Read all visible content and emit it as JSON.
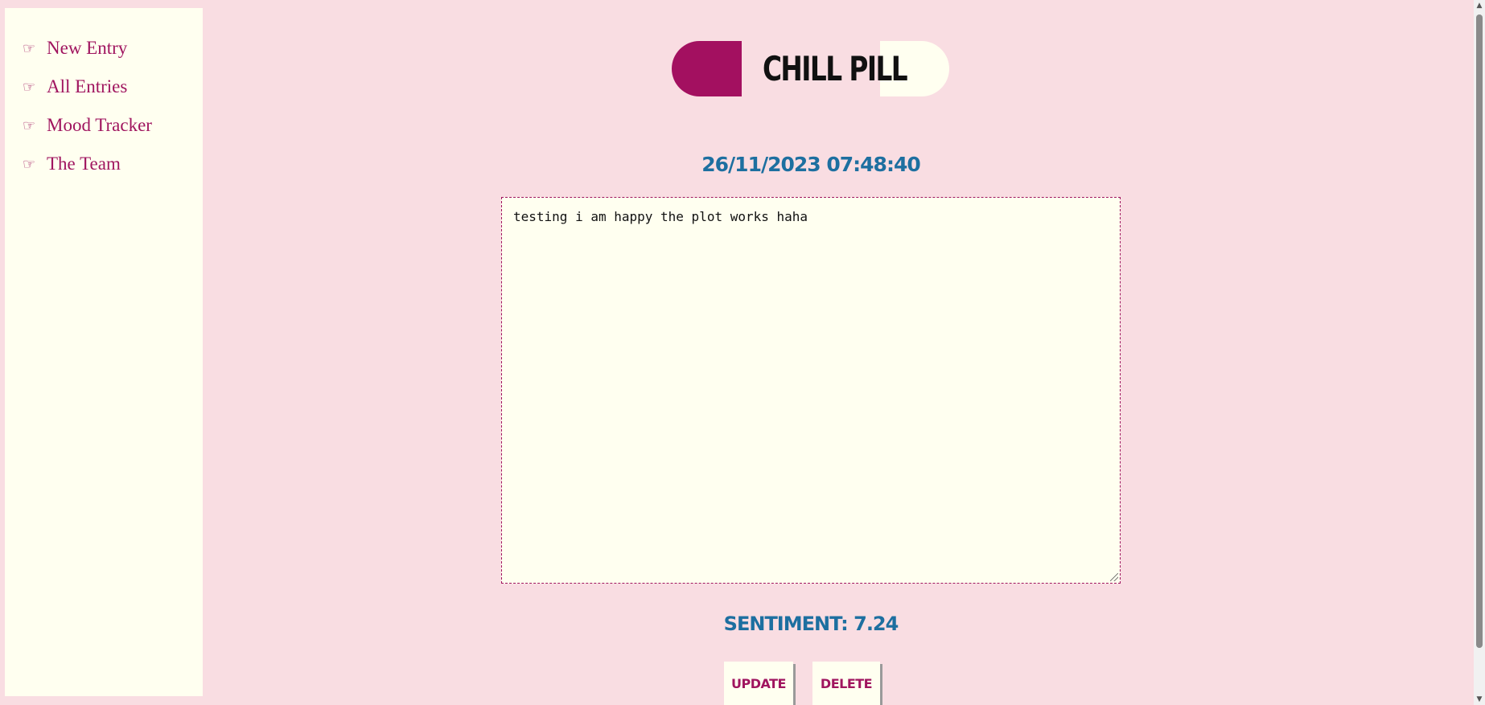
{
  "sidebar": {
    "items": [
      {
        "bullet": "☞",
        "label": "New Entry"
      },
      {
        "bullet": "☞",
        "label": "All Entries"
      },
      {
        "bullet": "☞",
        "label": "Mood Tracker"
      },
      {
        "bullet": "☞",
        "label": "The Team"
      }
    ]
  },
  "header": {
    "logo_text": "CHILL PILL"
  },
  "entry": {
    "timestamp": "26/11/2023 07:48:40",
    "text": "testing i am happy the plot works haha",
    "sentiment": "SENTIMENT: 7.24"
  },
  "actions": {
    "update_label": "UPDATE",
    "delete_label": "DELETE"
  },
  "colors": {
    "background": "#f9dde2",
    "panel": "#fffff0",
    "accent": "#a31060",
    "heading_blue": "#1d6fa0"
  },
  "icons": {
    "nav_bullet": "pointing-hand-icon"
  }
}
